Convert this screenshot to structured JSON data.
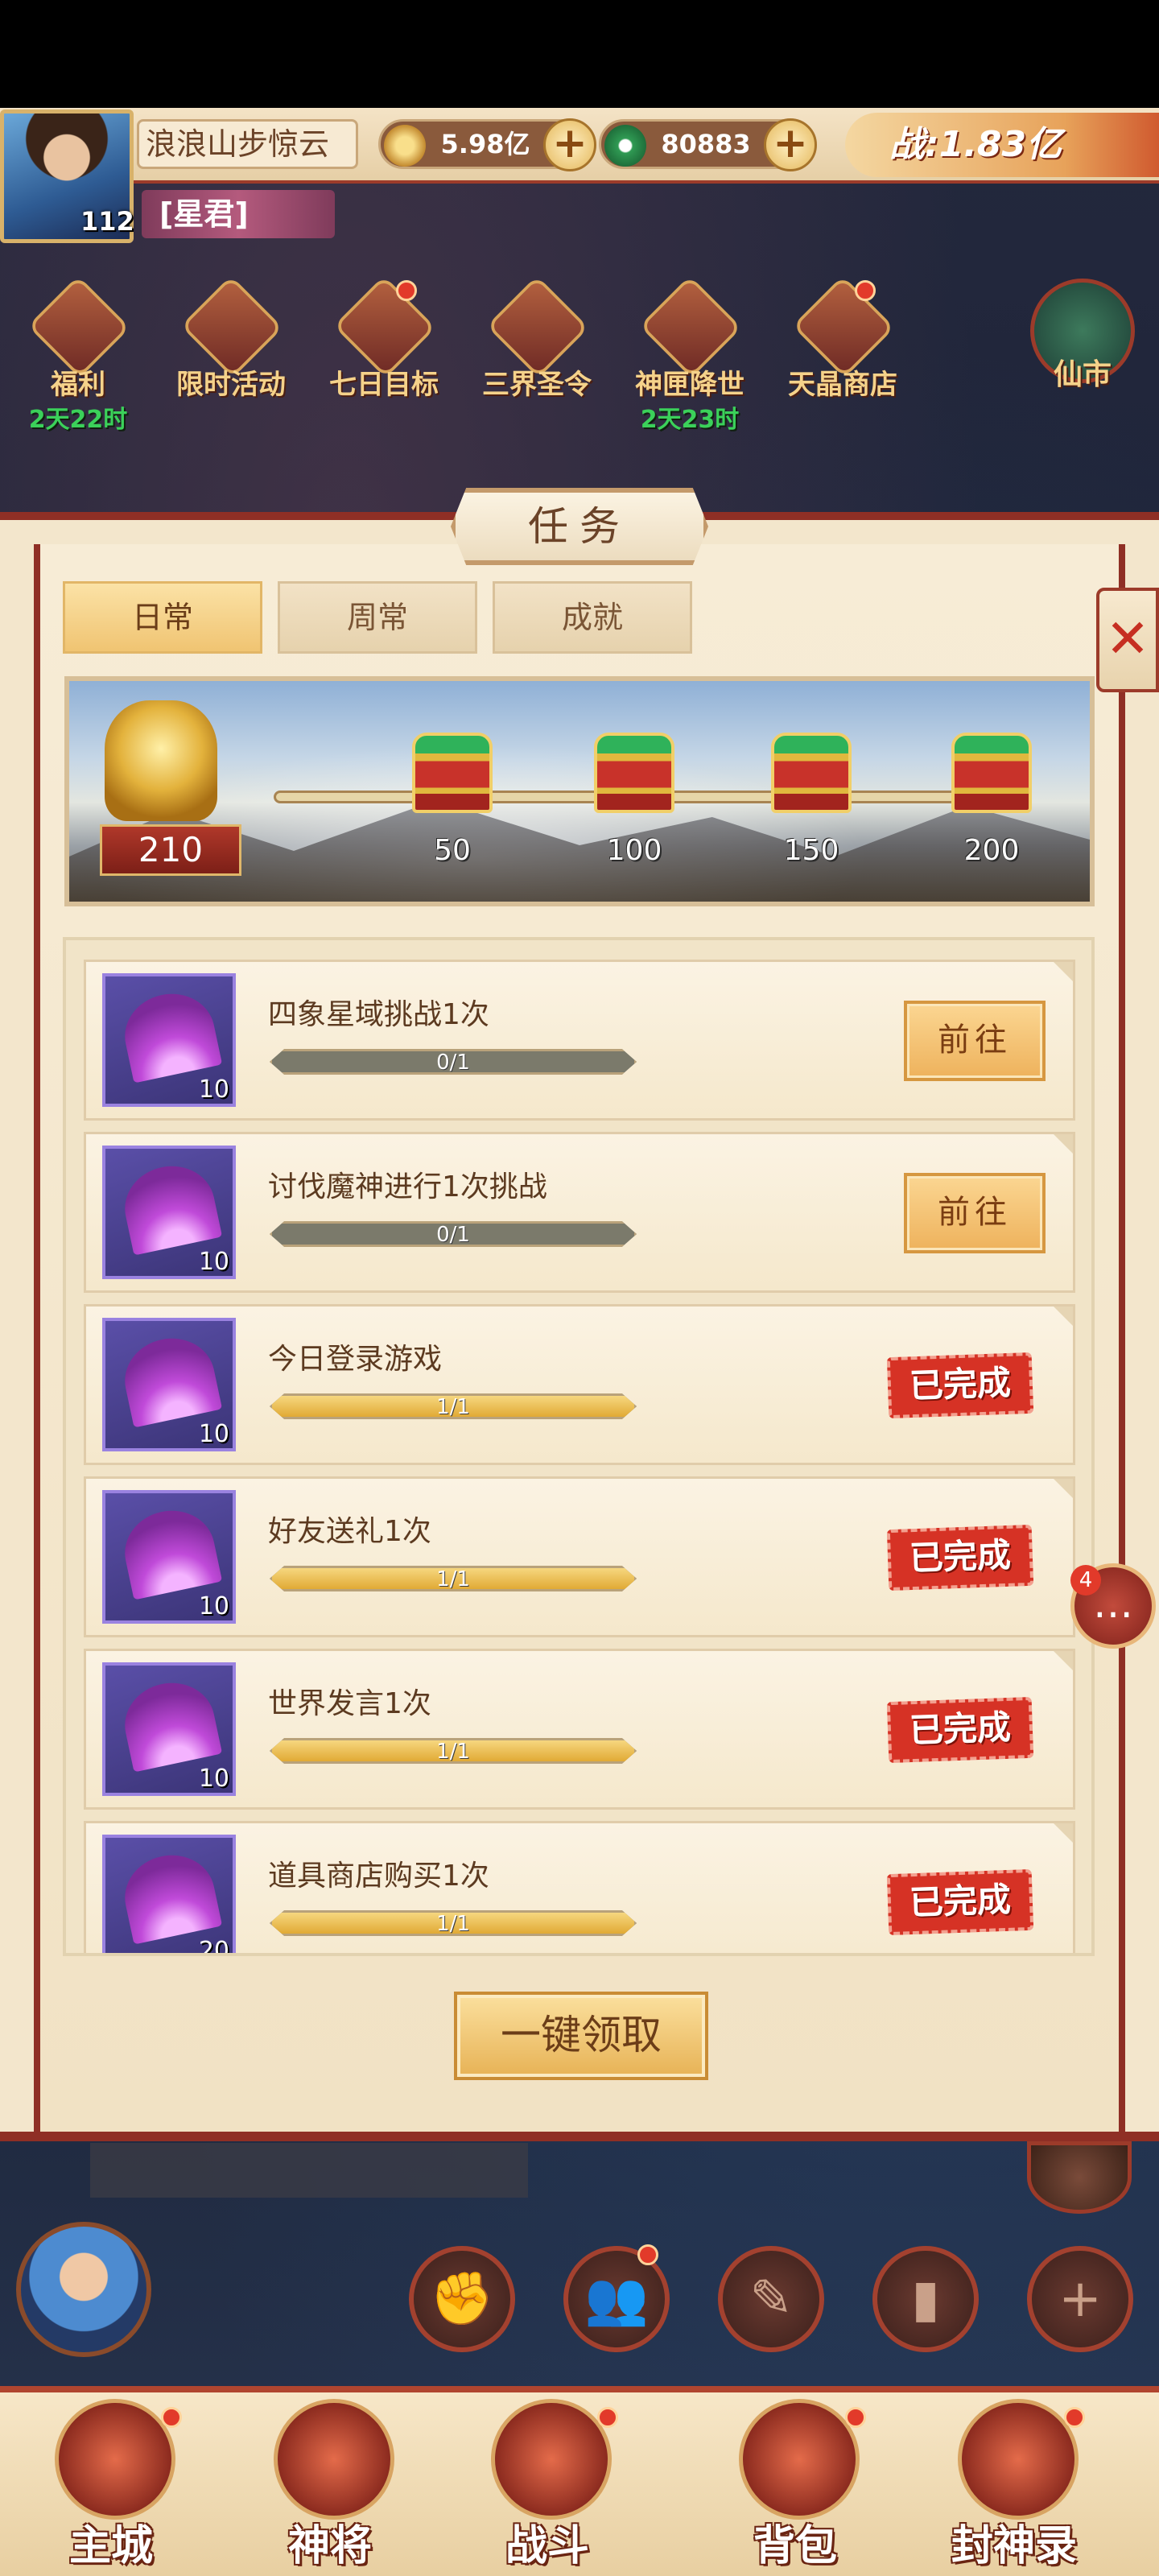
{
  "player": {
    "name": "浪浪山步惊云",
    "level": "112",
    "title": "[星君]",
    "gold": "5.98亿",
    "jade": "80883",
    "power": "战:1.83亿"
  },
  "activities": [
    {
      "label": "福利",
      "timer": "2天22时"
    },
    {
      "label": "限时活动",
      "timer": ""
    },
    {
      "label": "七日目标",
      "timer": ""
    },
    {
      "label": "三界圣令",
      "timer": ""
    },
    {
      "label": "神匣降世",
      "timer": "2天23时"
    },
    {
      "label": "天晶商店",
      "timer": ""
    }
  ],
  "side_shop": "仙市",
  "panel": {
    "title": "任务",
    "close": "✕",
    "tabs": [
      "日常",
      "周常",
      "成就"
    ],
    "active_tab": 0
  },
  "progress": {
    "score": "210",
    "milestones": [
      "50",
      "100",
      "150",
      "200"
    ]
  },
  "tasks": [
    {
      "name": "四象星域挑战1次",
      "progress": "0/1",
      "fraction": 0,
      "reward_qty": "10",
      "status": "go",
      "go_label": "前往",
      "done_label": ""
    },
    {
      "name": "讨伐魔神进行1次挑战",
      "progress": "0/1",
      "fraction": 0,
      "reward_qty": "10",
      "status": "go",
      "go_label": "前往",
      "done_label": ""
    },
    {
      "name": "今日登录游戏",
      "progress": "1/1",
      "fraction": 1,
      "reward_qty": "10",
      "status": "done",
      "go_label": "",
      "done_label": "已完成"
    },
    {
      "name": "好友送礼1次",
      "progress": "1/1",
      "fraction": 1,
      "reward_qty": "10",
      "status": "done",
      "go_label": "",
      "done_label": "已完成"
    },
    {
      "name": "世界发言1次",
      "progress": "1/1",
      "fraction": 1,
      "reward_qty": "10",
      "status": "done",
      "go_label": "",
      "done_label": "已完成"
    },
    {
      "name": "道具商店购买1次",
      "progress": "1/1",
      "fraction": 1,
      "reward_qty": "20",
      "status": "done",
      "go_label": "",
      "done_label": "已完成"
    }
  ],
  "claim_all": "一键领取",
  "chat_badge": "4",
  "nav": [
    "主城",
    "神将",
    "战斗",
    "背包",
    "封神录"
  ],
  "colors": {
    "panel_border": "#8f2f25",
    "done_stamp": "#d63225",
    "progress_fill": "#e1aa35",
    "go_button": "#eeb25c"
  }
}
